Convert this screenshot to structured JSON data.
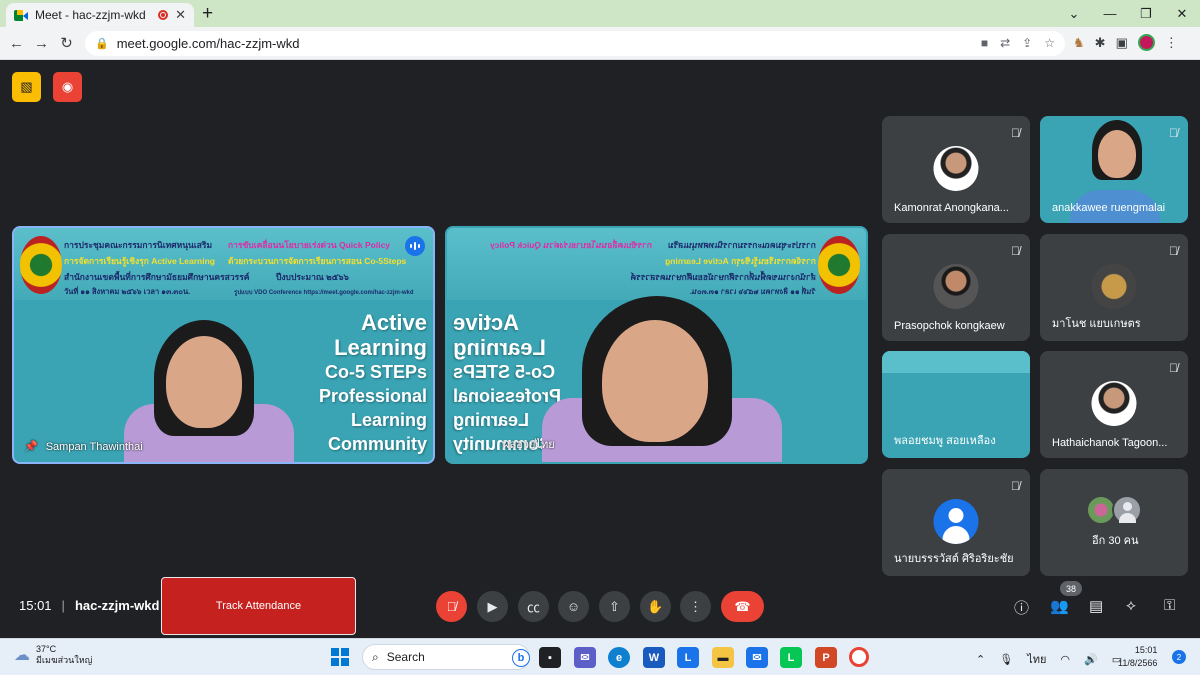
{
  "browser": {
    "tab_title": "Meet - hac-zzjm-wkd",
    "tab_close": "✕",
    "new_tab": "+",
    "url": "meet.google.com/hac-zzjm-wkd",
    "window_controls": [
      "⌄",
      "—",
      "❐",
      "✕"
    ]
  },
  "meeting": {
    "time": "15:01",
    "separator": "|",
    "code": "hac-zzjm-wkd",
    "track_attendance_label": "Track Attendance",
    "participants_count": "38",
    "colors": {
      "end_call": "#ea4335",
      "track_button": "#c5221f",
      "accent": "#1a73e8"
    }
  },
  "main_tiles": [
    {
      "name": "Sampan Thawinthai",
      "banner": {
        "line1": "การประชุมคณะกรรมการนิเทศหนุนเสริม",
        "line1_highlight": "การขับเคลื่อนนโยบายเร่งด่วน Quick Policy",
        "line2": "การจัดการเรียนรู้เชิงรุก Active Learning",
        "line2b": "ด้วยกระบวนการจัดการเรียนการสอน Co-5Steps",
        "line3": "สำนักงานเขตพื้นที่การศึกษามัธยมศึกษานครสวรรค์",
        "line3b": "ปีงบประมาณ ๒๕๖๖",
        "line4": "วันที่ ๑๑ สิงหาคม ๒๕๖๖ เวลา ๑๓.๓๐น.",
        "line4b": "รูปแบบ VDO Conference https://meet.google.com/hac-zzjm-wkd"
      },
      "slide_text": [
        "Active",
        "Learning",
        "Co-5 STEPs",
        "Professional",
        "Learning",
        "Community"
      ]
    },
    {
      "name": "ผลอวยไทย",
      "slide_text": [
        "Active",
        "Learning",
        "Co-5 STEPs",
        "Professional",
        "Learning",
        "Community"
      ]
    }
  ],
  "side_tiles": [
    {
      "name": "Kamonrat Anongkana...",
      "mute_icon": "🎙"
    },
    {
      "name": "anakkawee ruengmalai",
      "mute_icon": "🎙"
    },
    {
      "name": "Prasopchok kongkaew",
      "mute_icon": "🎙"
    },
    {
      "name": "มาโนช แยบเกษตร",
      "mute_icon": "🎙"
    },
    {
      "name": "พลอยชมพู สอยเหลือง",
      "mute_icon": "🎙"
    },
    {
      "name": "Hathaichanok Tagoon...",
      "mute_icon": "🎙"
    },
    {
      "name": "นายบรรรวัสต์ ศิริอริยะชัย",
      "mute_icon": "🎙"
    },
    {
      "name": "อีก 30 คน"
    }
  ],
  "taskbar": {
    "weather_temp": "37°C",
    "weather_desc": "มีเมฆส่วนใหญ่",
    "search_label": "Search",
    "language": "ไทย",
    "clock_time": "15:01",
    "clock_date": "11/8/2566",
    "notification_count": "2"
  }
}
